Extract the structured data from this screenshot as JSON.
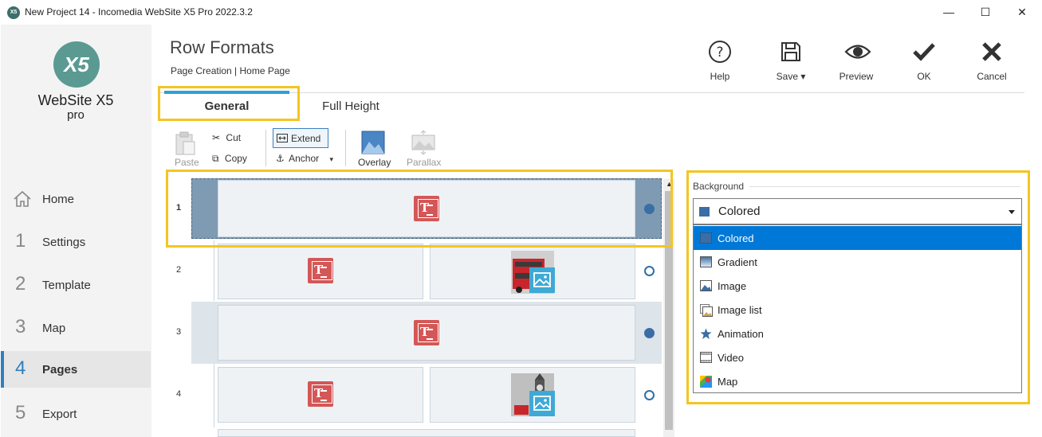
{
  "window": {
    "app_icon_text": "X5",
    "title": "New Project 14 - Incomedia WebSite X5 Pro 2022.3.2",
    "minimize": "—",
    "maximize": "☐",
    "close": "✕"
  },
  "sidebar": {
    "logo_mark": "X5",
    "logo_name": "WebSite X5",
    "logo_edition": "pro",
    "items": [
      {
        "num": "",
        "label": "Home"
      },
      {
        "num": "1",
        "label": "Settings"
      },
      {
        "num": "2",
        "label": "Template"
      },
      {
        "num": "3",
        "label": "Map"
      },
      {
        "num": "4",
        "label": "Pages"
      },
      {
        "num": "5",
        "label": "Export"
      }
    ],
    "active_index": 4
  },
  "header": {
    "title": "Row Formats",
    "breadcrumb": "Page Creation | Home Page",
    "buttons": {
      "help": "Help",
      "save": "Save",
      "preview": "Preview",
      "ok": "OK",
      "cancel": "Cancel"
    }
  },
  "tabs": [
    {
      "label": "General",
      "active": true
    },
    {
      "label": "Full Height",
      "active": false
    }
  ],
  "ribbon": {
    "paste": "Paste",
    "cut": "Cut",
    "copy": "Copy",
    "extend": "Extend",
    "anchor": "Anchor",
    "overlay": "Overlay",
    "parallax": "Parallax"
  },
  "rows": [
    {
      "num": "1",
      "selected": true,
      "radio": "filled",
      "cells": [
        "text"
      ]
    },
    {
      "num": "2",
      "selected": false,
      "radio": "empty",
      "cells": [
        "text",
        "image-bus"
      ]
    },
    {
      "num": "3",
      "selected": false,
      "radio": "filled",
      "cells": [
        "text"
      ]
    },
    {
      "num": "4",
      "selected": false,
      "radio": "empty",
      "cells": [
        "text",
        "image-bigben"
      ]
    }
  ],
  "background": {
    "legend": "Background",
    "selected": "Colored",
    "options": [
      {
        "label": "Colored",
        "icon": "color-swatch-icon"
      },
      {
        "label": "Gradient",
        "icon": "gradient-icon"
      },
      {
        "label": "Image",
        "icon": "image-icon"
      },
      {
        "label": "Image list",
        "icon": "image-list-icon"
      },
      {
        "label": "Animation",
        "icon": "star-icon"
      },
      {
        "label": "Video",
        "icon": "film-icon"
      },
      {
        "label": "Map",
        "icon": "map-pin-icon"
      }
    ]
  },
  "colors": {
    "accent": "#2f9fd6",
    "highlight": "#f3c522",
    "selected_row": "#7f9bb3",
    "dropdown_selected": "#0078d7",
    "text_element": "#d45757"
  }
}
